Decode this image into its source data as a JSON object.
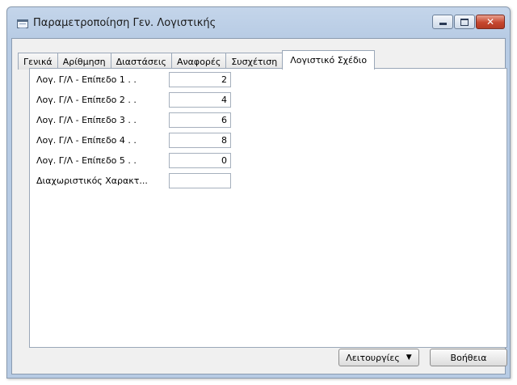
{
  "window": {
    "title": "Παραμετροποίηση Γεν. Λογιστικής",
    "minimize_icon": "minimize-icon",
    "maximize_icon": "maximize-icon",
    "close_icon": "close-icon",
    "close_glyph": "✕"
  },
  "tabs": [
    {
      "label": "Γενικά"
    },
    {
      "label": "Αρίθμηση"
    },
    {
      "label": "Διαστάσεις"
    },
    {
      "label": "Αναφορές"
    },
    {
      "label": "Συσχέτιση"
    },
    {
      "label": "Λογιστικό Σχέδιο",
      "active": true
    }
  ],
  "fields": [
    {
      "label": "Λογ. Γ/Λ - Επίπεδο 1 . .",
      "value": "2"
    },
    {
      "label": "Λογ. Γ/Λ - Επίπεδο 2 . .",
      "value": "4"
    },
    {
      "label": "Λογ. Γ/Λ - Επίπεδο 3 . .",
      "value": "6"
    },
    {
      "label": "Λογ. Γ/Λ - Επίπεδο 4 . .",
      "value": "8"
    },
    {
      "label": "Λογ. Γ/Λ - Επίπεδο 5 . .",
      "value": "0"
    },
    {
      "label": "Διαχωριστικός Χαρακτ...",
      "value": ""
    }
  ],
  "buttons": {
    "functions_label": "Λειτουργίες",
    "functions_arrow": "▼",
    "help_label": "Βοήθεια"
  },
  "colors": {
    "title_gradient": "#c4d5ea",
    "close_button": "#c6472f"
  }
}
